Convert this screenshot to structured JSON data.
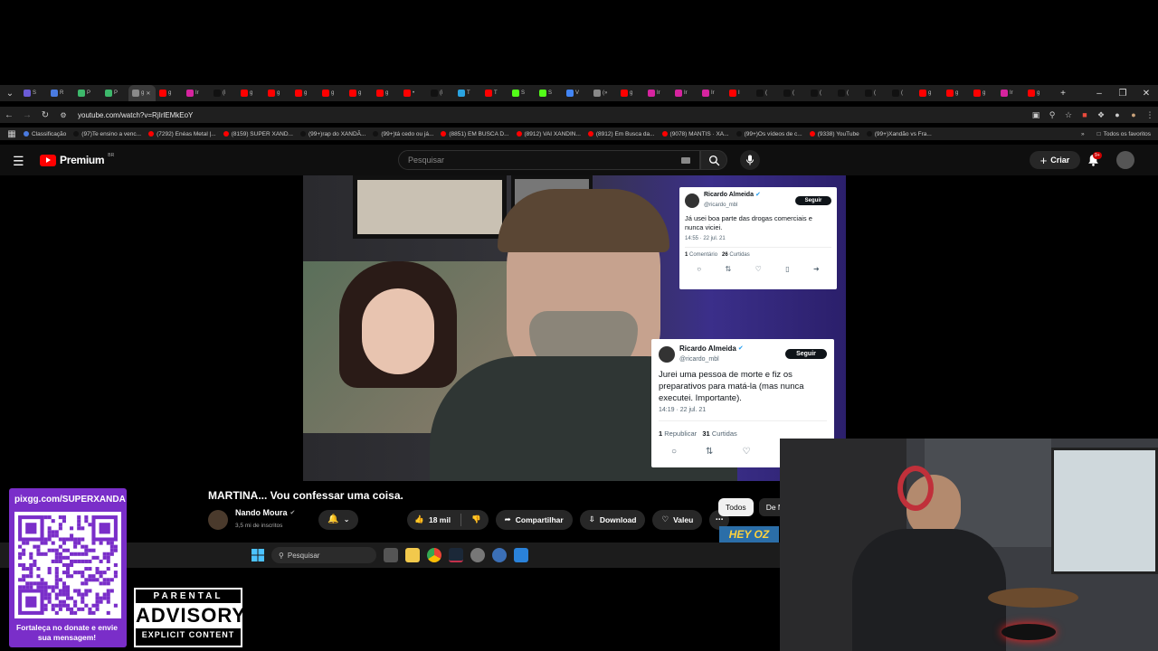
{
  "browser": {
    "tabs": [
      {
        "label": "S",
        "color": "#6b5bd6"
      },
      {
        "label": "R",
        "color": "#4a7be0"
      },
      {
        "label": "P",
        "color": "#3db86b"
      },
      {
        "label": "P",
        "color": "#3db86b"
      },
      {
        "label": "g",
        "color": "#8a8a8a",
        "active": true
      },
      {
        "label": "g",
        "color": "#ff0000"
      },
      {
        "label": "Ir",
        "color": "#d6249f"
      },
      {
        "label": "(i",
        "color": "#111"
      },
      {
        "label": "g",
        "color": "#ff0000"
      },
      {
        "label": "g",
        "color": "#ff0000"
      },
      {
        "label": "g",
        "color": "#ff0000"
      },
      {
        "label": "g",
        "color": "#ff0000"
      },
      {
        "label": "g",
        "color": "#ff0000"
      },
      {
        "label": "g",
        "color": "#ff0000"
      },
      {
        "label": "•",
        "color": "#ff0000"
      },
      {
        "label": "(i",
        "color": "#111"
      },
      {
        "label": "T",
        "color": "#2aa3e0"
      },
      {
        "label": "T",
        "color": "#ff0000"
      },
      {
        "label": "S",
        "color": "#53fc18"
      },
      {
        "label": "S",
        "color": "#53fc18"
      },
      {
        "label": "V",
        "color": "#4285f4"
      },
      {
        "label": "(»",
        "color": "#888"
      },
      {
        "label": "g",
        "color": "#ff0000"
      },
      {
        "label": "Ir",
        "color": "#d6249f"
      },
      {
        "label": "Ir",
        "color": "#d6249f"
      },
      {
        "label": "Ir",
        "color": "#d6249f"
      },
      {
        "label": "I",
        "color": "#ff0000"
      },
      {
        "label": "(",
        "color": "#111"
      },
      {
        "label": "(",
        "color": "#111"
      },
      {
        "label": "(",
        "color": "#111"
      },
      {
        "label": "(",
        "color": "#111"
      },
      {
        "label": "(",
        "color": "#111"
      },
      {
        "label": "(",
        "color": "#111"
      },
      {
        "label": "g",
        "color": "#ff0000"
      },
      {
        "label": "g",
        "color": "#ff0000"
      },
      {
        "label": "g",
        "color": "#ff0000"
      },
      {
        "label": "Ir",
        "color": "#d6249f"
      },
      {
        "label": "g",
        "color": "#ff0000"
      }
    ],
    "url": "youtube.com/watch?v=RjIrlEMkEoY",
    "bookmarks": [
      {
        "label": "Classificação",
        "color": "#4a7be0"
      },
      {
        "label": "(97)Te ensino a venc...",
        "color": "#111"
      },
      {
        "label": "(7292) Enéas Metal |...",
        "color": "#ff0000"
      },
      {
        "label": "(8159) SUPER XAND...",
        "color": "#ff0000"
      },
      {
        "label": "(99+)rap do XANDÃ...",
        "color": "#111"
      },
      {
        "label": "(99+)tá cedo ou já...",
        "color": "#111"
      },
      {
        "label": "(8851) EM BUSCA D...",
        "color": "#ff0000"
      },
      {
        "label": "(8912) VAI XANDIN...",
        "color": "#ff0000"
      },
      {
        "label": "(8912) Em Busca da...",
        "color": "#ff0000"
      },
      {
        "label": "(9078) MANTIS · XA...",
        "color": "#ff0000"
      },
      {
        "label": "(99+)Os vídeos de c...",
        "color": "#111"
      },
      {
        "label": "(9338) YouTube",
        "color": "#ff0000"
      },
      {
        "label": "(99+)Xandão vs Fra...",
        "color": "#111"
      }
    ],
    "all_bookmarks": "Todos os favoritos"
  },
  "youtube": {
    "brand": "Premium",
    "country": "BR",
    "search_placeholder": "Pesquisar",
    "create_label": "Criar",
    "notif_badge": "9+",
    "video_title": "MARTINA... Vou confessar uma coisa.",
    "channel_name": "Nando Moura",
    "subscribers": "3,5 mi de inscritos",
    "like_count": "18 mil",
    "share_label": "Compartilhar",
    "download_label": "Download",
    "thanks_label": "Valeu",
    "chips": [
      "Todos",
      "De N"
    ]
  },
  "tweet1": {
    "name": "Ricardo Almeida",
    "handle": "@ricardo_mbl",
    "follow": "Seguir",
    "text": "Já usei boa parte das drogas comerciais e nunca viciei.",
    "time": "14:55 · 22 jul. 21",
    "stat1_num": "1",
    "stat1_label": "Comentário",
    "stat2_num": "26",
    "stat2_label": "Curtidas"
  },
  "tweet2": {
    "name": "Ricardo Almeida",
    "handle": "@ricardo_mbl",
    "follow": "Seguir",
    "text": "Jurei uma pessoa de morte e fiz os preparativos para matá-la (mas nunca executei. Importante).",
    "time": "14:19 · 22 jul. 21",
    "stat1_num": "1",
    "stat1_label": "Republicar",
    "stat2_num": "31",
    "stat2_label": "Curtidas"
  },
  "taskbar": {
    "search_label": "Pesquisar"
  },
  "overlay": {
    "qr_url": "pixgg.com/SUPERXANDA",
    "qr_message": "Fortaleça no donate e envie sua mensagem!",
    "advisory_top": "PARENTAL",
    "advisory_mid": "ADVISORY",
    "advisory_bottom": "EXPLICIT CONTENT",
    "heyoz": "HEY OZ"
  }
}
